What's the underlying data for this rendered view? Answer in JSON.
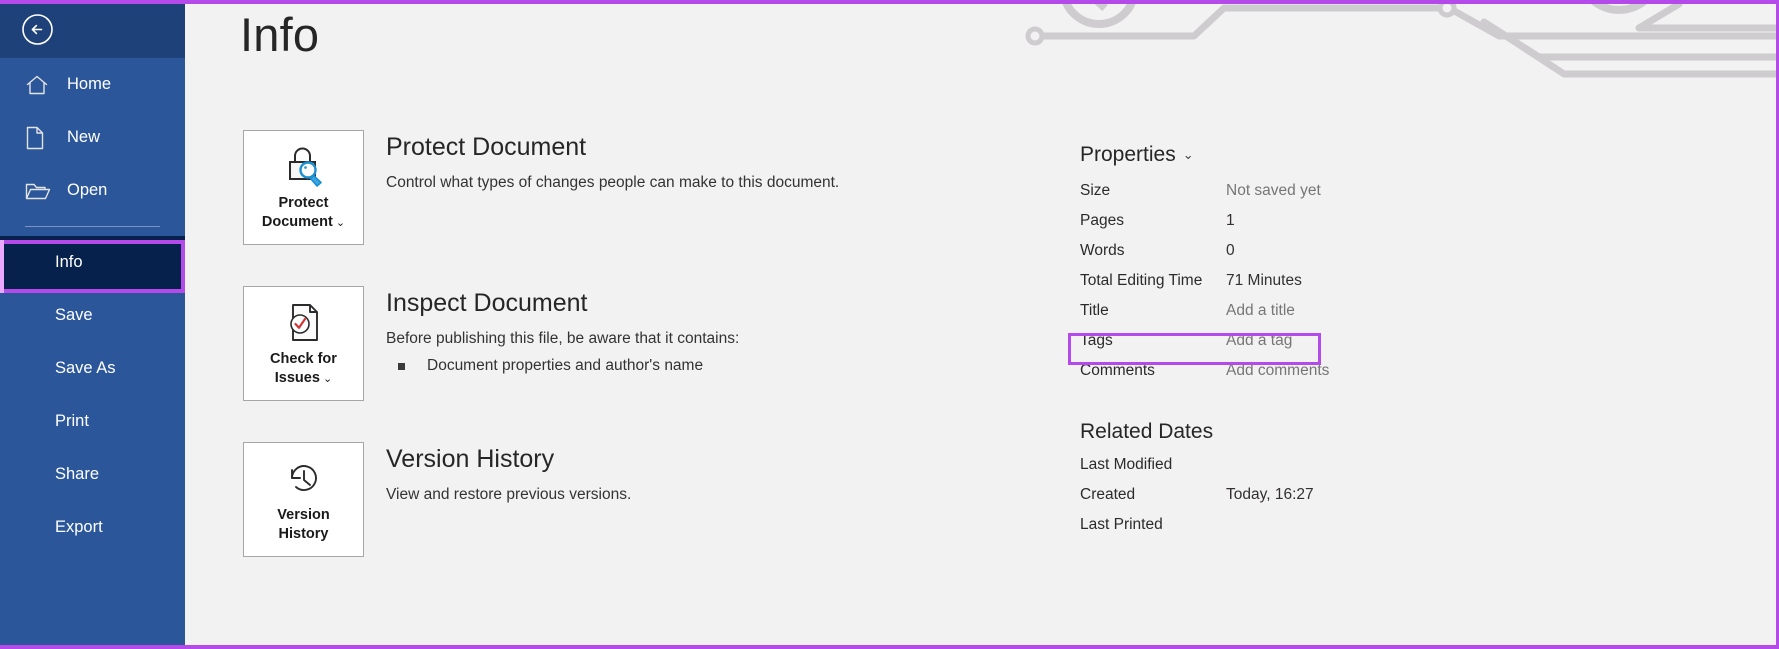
{
  "window": {
    "page_title": "Info",
    "accent_highlight": "#b44aea",
    "sidebar_color": "#2b579a",
    "sidebar_active_color": "#06224c"
  },
  "sidebar": {
    "back_button": "back-arrow",
    "items": [
      {
        "label": "Home",
        "icon": "home-icon",
        "has_icon": true,
        "active": false
      },
      {
        "label": "New",
        "icon": "page-icon",
        "has_icon": true,
        "active": false
      },
      {
        "label": "Open",
        "icon": "folder-icon",
        "has_icon": true,
        "active": false
      },
      {
        "label": "Info",
        "icon": "",
        "has_icon": false,
        "active": true
      },
      {
        "label": "Save",
        "icon": "",
        "has_icon": false,
        "active": false
      },
      {
        "label": "Save As",
        "icon": "",
        "has_icon": false,
        "active": false
      },
      {
        "label": "Print",
        "icon": "",
        "has_icon": false,
        "active": false
      },
      {
        "label": "Share",
        "icon": "",
        "has_icon": false,
        "active": false
      },
      {
        "label": "Export",
        "icon": "",
        "has_icon": false,
        "active": false
      }
    ]
  },
  "main": {
    "blocks": [
      {
        "tile_label": "Protect\nDocument",
        "tile_has_chevron": true,
        "tile_icon": "lock-magnifier-icon",
        "title": "Protect Document",
        "desc": "Control what types of changes people can make to this document.",
        "bullets": []
      },
      {
        "tile_label": "Check for\nIssues",
        "tile_has_chevron": true,
        "tile_icon": "document-check-icon",
        "title": "Inspect Document",
        "desc": "Before publishing this file, be aware that it contains:",
        "bullets": [
          "Document properties and author's name"
        ]
      },
      {
        "tile_label": "Version\nHistory",
        "tile_has_chevron": false,
        "tile_icon": "clock-rewind-icon",
        "title": "Version History",
        "desc": "View and restore previous versions.",
        "bullets": []
      }
    ]
  },
  "properties": {
    "heading": "Properties",
    "rows": [
      {
        "key": "Size",
        "value": "Not saved yet",
        "placeholder": true,
        "highlighted": false
      },
      {
        "key": "Pages",
        "value": "1",
        "placeholder": false,
        "highlighted": false
      },
      {
        "key": "Words",
        "value": "0",
        "placeholder": false,
        "highlighted": false
      },
      {
        "key": "Total Editing Time",
        "value": "71 Minutes",
        "placeholder": false,
        "highlighted": false
      },
      {
        "key": "Title",
        "value": "Add a title",
        "placeholder": true,
        "highlighted": false
      },
      {
        "key": "Tags",
        "value": "Add a tag",
        "placeholder": true,
        "highlighted": true
      },
      {
        "key": "Comments",
        "value": "Add comments",
        "placeholder": true,
        "highlighted": false
      }
    ]
  },
  "related_dates": {
    "heading": "Related Dates",
    "rows": [
      {
        "key": "Last Modified",
        "value": ""
      },
      {
        "key": "Created",
        "value": "Today, 16:27"
      },
      {
        "key": "Last Printed",
        "value": ""
      }
    ]
  }
}
